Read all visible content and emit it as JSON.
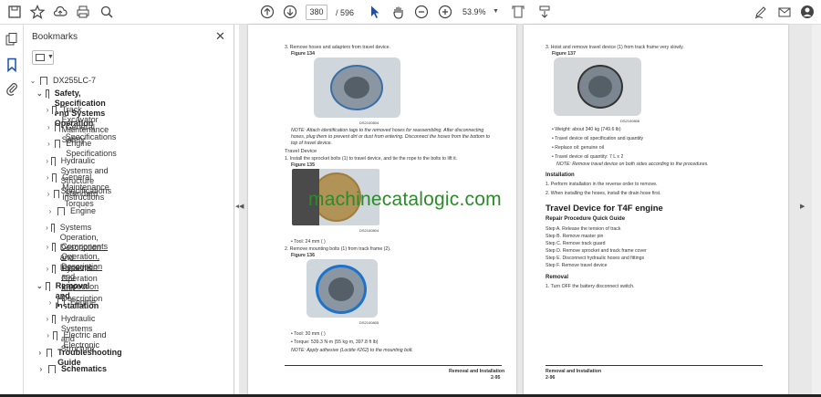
{
  "toolbar": {
    "page_current": "380",
    "page_total": "/ 596",
    "zoom": "53.9%"
  },
  "bookmarks_panel": {
    "title": "Bookmarks",
    "root": "DX255LC-7",
    "items": [
      {
        "label": "Safety, Specification and Systems Operation",
        "level": 1,
        "bold": true,
        "expanded": true
      },
      {
        "label": "Track Excavator Maintenance Safety",
        "level": 2
      },
      {
        "label": "General Specifications",
        "level": 2
      },
      {
        "label": "Engine Specifications",
        "level": 2
      },
      {
        "label": "Hydraulic Systems and Structure Specifications",
        "level": 2
      },
      {
        "label": "General Maintenance Instructions",
        "level": 2
      },
      {
        "label": "Standard Torques",
        "level": 2
      },
      {
        "label": "Engine",
        "level": 2
      },
      {
        "label": "Systems Operation, Description and Inspection",
        "level": 2
      },
      {
        "label": "Components Operation, Description and",
        "label2": "Inspection",
        "level": 2
      },
      {
        "label": "Systems Operation and Description",
        "level": 2
      },
      {
        "label": "Removal and Installation",
        "level": 1,
        "bold": true,
        "expanded": true
      },
      {
        "label": "Engine",
        "level": 2
      },
      {
        "label": "Hydraulic Systems and Structure",
        "level": 2
      },
      {
        "label": "Electric and Electronic",
        "level": 2
      },
      {
        "label": "Troubleshooting Guide",
        "level": 1,
        "bold": true
      },
      {
        "label": "Schematics",
        "level": 1,
        "bold": true
      }
    ]
  },
  "page_left": {
    "step3": "3.  Remove hoses and adapters from travel device.",
    "fig134": "Figure 134",
    "code134": "DS2100804",
    "note1a": "NOTE:   Attach identification tags to the removed hoses for reassembling. After disconnecting",
    "note1b": "hoses, plug them to prevent dirt or dust from entering. Disconnect the hoses from the bottom to",
    "note1c": "top of travel device.",
    "sub_travel": "Travel Device",
    "step1": "1.  Install the sprocket bolts (1) to travel device, and tie the rope to the bolts to lift it.",
    "fig135": "Figure 135",
    "code135": "DS2100804",
    "tool1": "•  Tool: 24 mm (    )",
    "step2": "2.  Remove mounting bolts (1) from track frame (2).",
    "fig136": "Figure 136",
    "code136": "DS2100805",
    "tool2": "•  Tool: 30 mm (    )",
    "torque": "•  Torque: 539.3 N·m (55 kg·m, 397.8 ft lb)",
    "note2": "NOTE:   Apply adhesive (Loctite #262) to the mounting bolt.",
    "footer_title": "Removal and Installation",
    "footer_page": "2-95"
  },
  "page_right": {
    "step3": "3.  Hoist and remove travel device (1) from track frame very slowly.",
    "fig137": "Figure 137",
    "code137": "DS2100806",
    "b1": "•  Weight: about 340 kg (749.6 lb)",
    "b2": "•  Travel device oil specification and quantity",
    "b3": "•  Replace oil: genuine oil",
    "b4": "•  Travel device oil quantity: 7 L x 2",
    "note": "NOTE:   Remove travel device on both sides according to the procedures.",
    "install_head": "Installation",
    "i1": "1.  Perform installation in the reverse order to remove.",
    "i2": "2.  When installing the hoses, install the drain hose first.",
    "heading": "Travel Device for T4F engine",
    "rpq_head": "Repair Procedure Quick Guide",
    "steps": [
      "Step A. Release the tension of track",
      "Step B. Remove master pin",
      "Step C. Remove track guard",
      "Step D. Remove sprocket and track frame cover",
      "Step E. Disconnect hydraulic hoses and fittings",
      "Step F. Remove travel device"
    ],
    "removal_head": "Removal",
    "r1": "1.  Turn OFF the battery disconnect switch.",
    "footer_title": "Removal and Installation",
    "footer_page": "2-96"
  },
  "watermark": "machinecatalogic.com"
}
